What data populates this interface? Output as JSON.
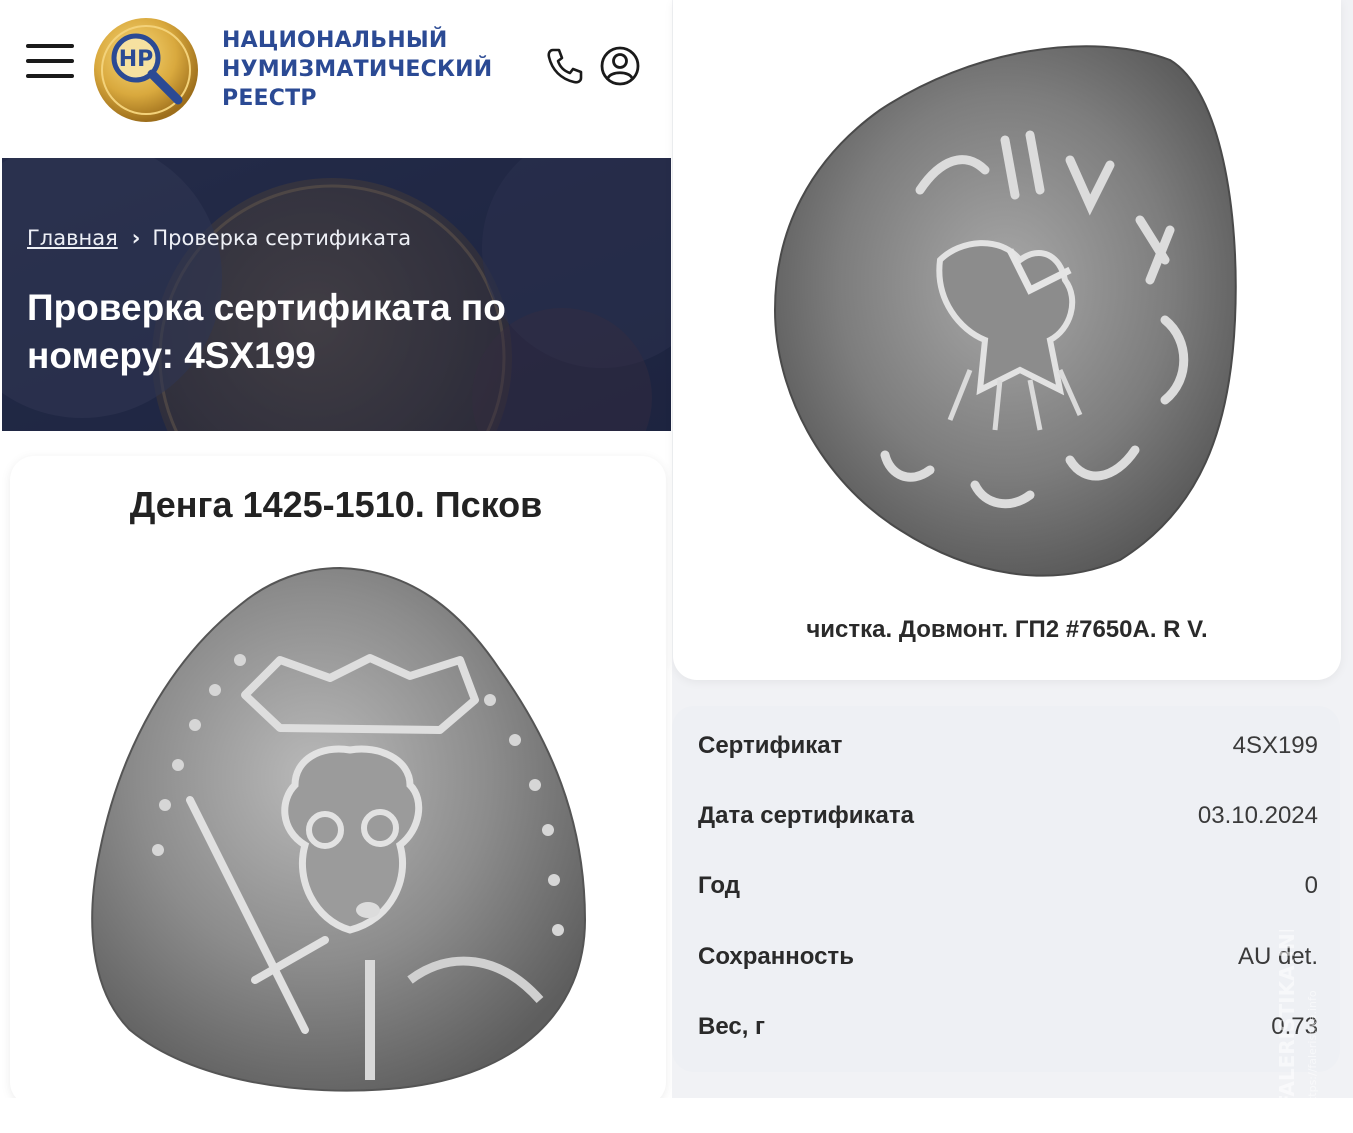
{
  "header": {
    "brand_lines": [
      "НАЦИОНАЛЬНЫЙ",
      "НУМИЗМАТИЧЕСКИЙ",
      "РЕЕСТР"
    ],
    "logo_text": "НР",
    "icons": [
      "menu-icon",
      "phone-icon",
      "user-icon"
    ]
  },
  "breadcrumb": {
    "home": "Главная",
    "separator": "›",
    "current": "Проверка сертификата"
  },
  "hero": {
    "title": "Проверка сертификата по номеру: 4SX199"
  },
  "coin": {
    "title": "Денга 1425-1510. Псков",
    "caption": "чистка. Довмонт. ГП2 #7650А. R V."
  },
  "details": [
    {
      "label": "Сертификат",
      "value": "4SX199"
    },
    {
      "label": "Дата сертификата",
      "value": "03.10.2024"
    },
    {
      "label": "Год",
      "value": "0"
    },
    {
      "label": "Сохранность",
      "value": "AU det."
    },
    {
      "label": "Вес, г",
      "value": "0.73"
    }
  ],
  "watermark": {
    "text": "FALERISTIKA.INFO",
    "url": "https://faleristika.info"
  },
  "colors": {
    "brand_blue": "#2b4a94",
    "hero_bg": "#2c3352",
    "gold": "#d4a73a",
    "panel_bg": "#eef0f4"
  }
}
